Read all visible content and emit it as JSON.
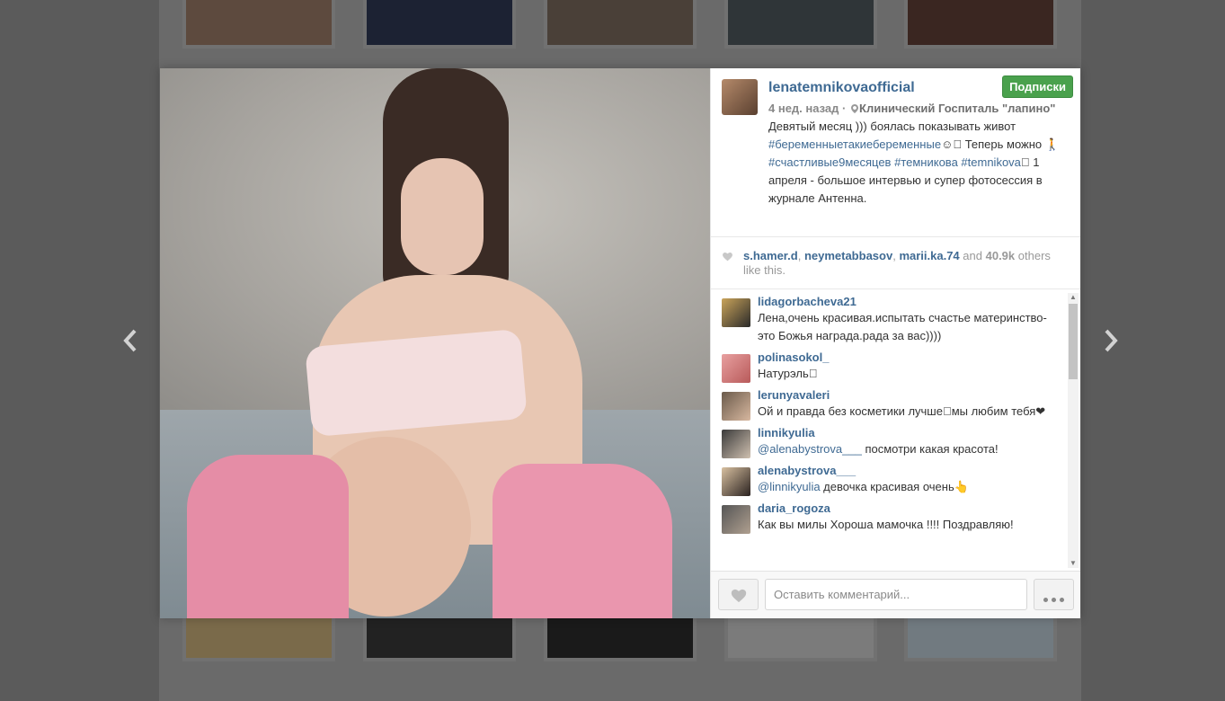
{
  "post": {
    "username": "lenatemnikovaofficial",
    "follow_label": "Подписки",
    "time": "4 нед. назад",
    "separator": "·",
    "location": "Клинический Госпиталь \"лапино\"",
    "caption_pre": "Девятый месяц ))) боялась показывать живот",
    "tag1": "#беременныетакиебеременные",
    "caption_mid": "☺\u0000 Теперь можно 🚶",
    "tag2": "#счастливые9месяцев",
    "tag3": "#темникова",
    "tag4": "#temnikova",
    "caption_post": "\u0000 1 апреля - большое интервью и супер фотосессия в журнале Антенна."
  },
  "likes": {
    "user1": "s.hamer.d",
    "user2": "neymetabbasov",
    "user3": "marii.ka.74",
    "and": "and",
    "count": "40.9k",
    "others": "others like this."
  },
  "comments": [
    {
      "user": "lidagorbacheva21",
      "text": "Лена,очень красивая.испытать счастье материнство-это Божья награда.рада за вас))))"
    },
    {
      "user": "polinasokol_",
      "text": "Натурэль\u0000"
    },
    {
      "user": "lerunyavaleri",
      "text": "Ой и правда без косметики лучше\u0000мы любим тебя❤"
    },
    {
      "user": "linnikyulia",
      "mention": "@alenabystrova___",
      "text": " посмотри какая красота!"
    },
    {
      "user": "alenabystrova___",
      "mention": "@linnikyulia",
      "text": " девочка красивая очень👆"
    },
    {
      "user": "daria_rogoza",
      "text": "Как вы милы Хороша мамочка !!!! Поздравляю!"
    }
  ],
  "comment_input": {
    "placeholder": "Оставить комментарий..."
  },
  "icons": {
    "prev": "chevron-left-icon",
    "next": "chevron-right-icon",
    "heart": "heart-icon",
    "more": "more-dots-icon",
    "location": "location-pin-icon"
  },
  "colors": {
    "link": "#3f6a93",
    "follow_bg": "#4aa14d",
    "overlay": "#5b5b5b"
  }
}
